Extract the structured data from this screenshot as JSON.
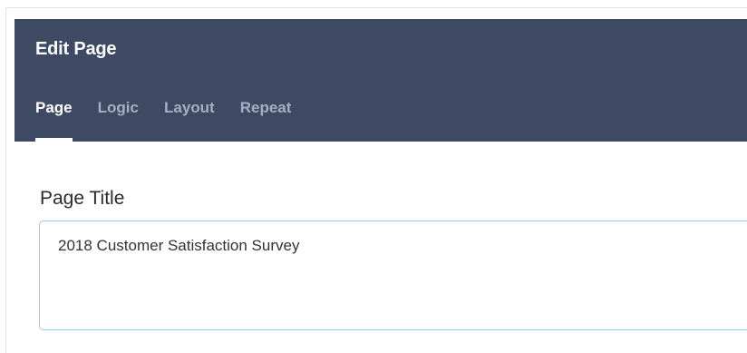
{
  "panel": {
    "title": "Edit Page"
  },
  "tabs": [
    {
      "label": "Page",
      "active": true
    },
    {
      "label": "Logic",
      "active": false
    },
    {
      "label": "Layout",
      "active": false
    },
    {
      "label": "Repeat",
      "active": false
    }
  ],
  "form": {
    "page_title_label": "Page Title",
    "page_title_value": "2018 Customer Satisfaction Survey"
  },
  "colors": {
    "header_bg": "#3e4964",
    "tab_active": "#ffffff",
    "tab_inactive": "#a6aec0",
    "input_border": "#9dc6ec"
  }
}
